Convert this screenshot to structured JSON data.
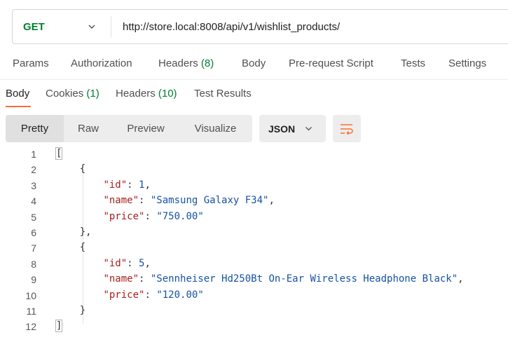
{
  "request": {
    "method": "GET",
    "url": "http://store.local:8008/api/v1/wishlist_products/"
  },
  "request_tabs": [
    {
      "label": "Params",
      "count": ""
    },
    {
      "label": "Authorization",
      "count": ""
    },
    {
      "label": "Headers",
      "count": "(8)"
    },
    {
      "label": "Body",
      "count": ""
    },
    {
      "label": "Pre-request Script",
      "count": ""
    },
    {
      "label": "Tests",
      "count": ""
    },
    {
      "label": "Settings",
      "count": ""
    }
  ],
  "response_tabs": [
    {
      "label": "Body",
      "count": ""
    },
    {
      "label": "Cookies",
      "count": "(1)"
    },
    {
      "label": "Headers",
      "count": "(10)"
    },
    {
      "label": "Test Results",
      "count": ""
    }
  ],
  "view_modes": [
    "Pretty",
    "Raw",
    "Preview",
    "Visualize"
  ],
  "format": "JSON",
  "icons": {
    "method_dropdown": "chevron-down-icon",
    "format_dropdown": "chevron-down-icon",
    "wrap": "text-wrap-icon"
  },
  "colors": {
    "method": "#007f31",
    "accent": "#ff6c37",
    "json_key": "#a4221d",
    "json_value": "#1652a3"
  },
  "response_body": {
    "line_numbers": [
      "1",
      "2",
      "3",
      "4",
      "5",
      "6",
      "7",
      "8",
      "9",
      "10",
      "11",
      "12"
    ],
    "items": [
      {
        "id": "1",
        "name": "\"Samsung Galaxy F34\"",
        "price": "\"750.00\""
      },
      {
        "id": "5",
        "name": "\"Sennheiser Hd250Bt On-Ear Wireless Headphone Black\"",
        "price": "\"120.00\""
      }
    ],
    "keys": {
      "id": "\"id\"",
      "name": "\"name\"",
      "price": "\"price\""
    }
  }
}
